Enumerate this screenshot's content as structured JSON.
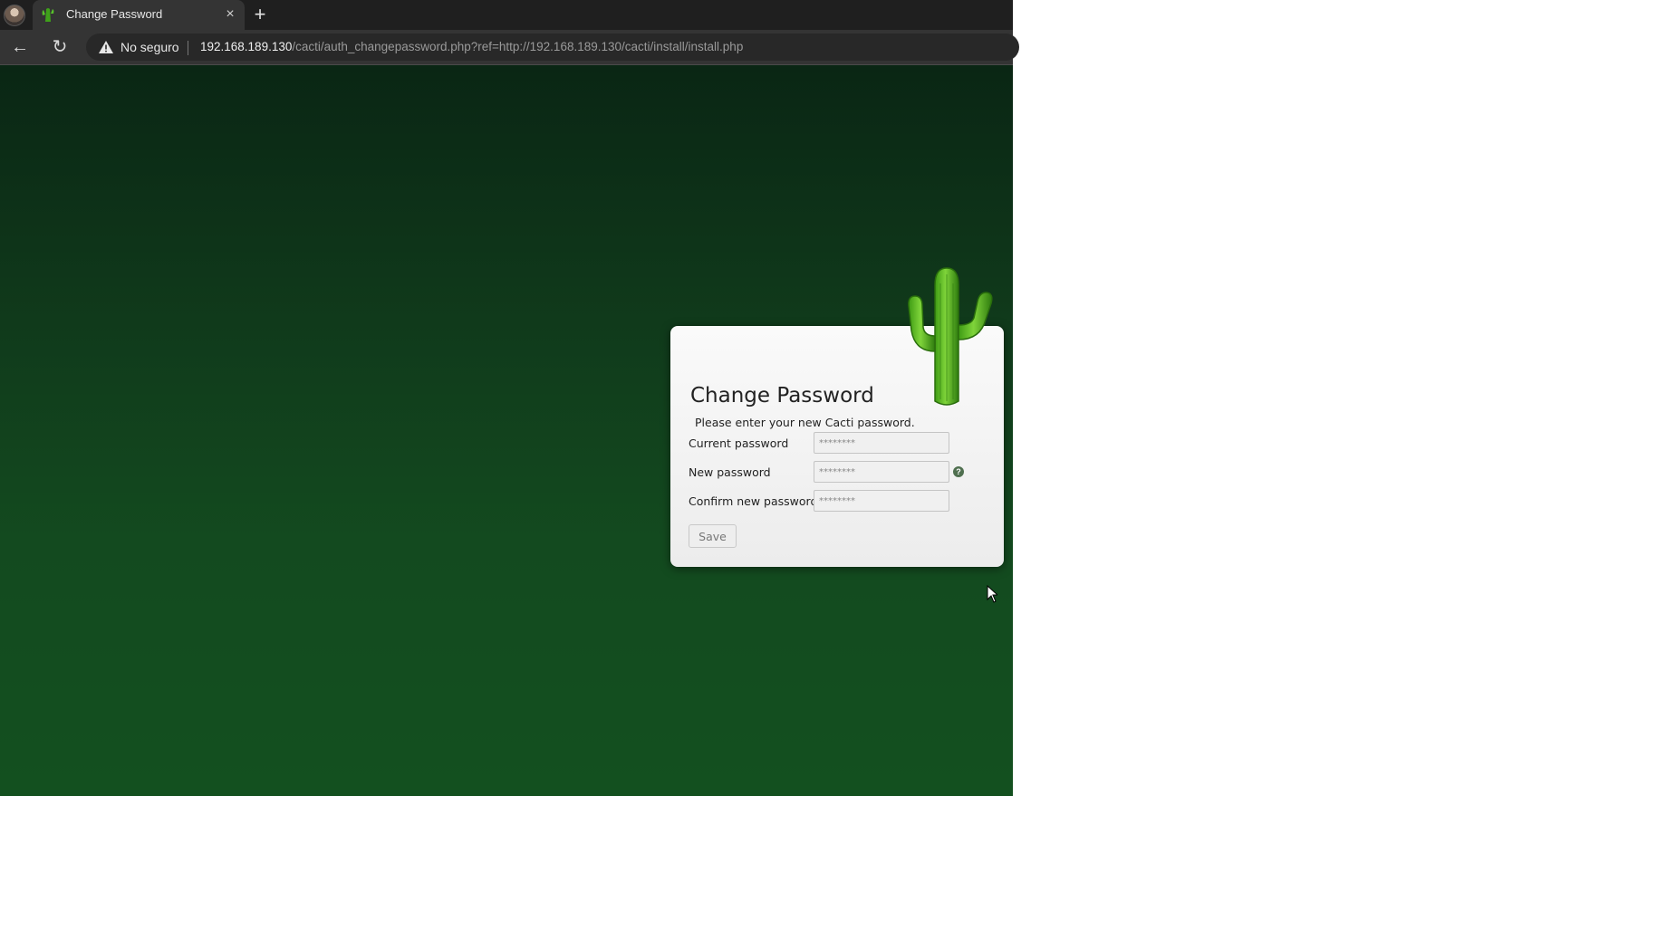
{
  "browser": {
    "tab": {
      "title": "Change Password",
      "close_glyph": "×",
      "favicon": "cactus-favicon"
    },
    "new_tab_glyph": "+",
    "toolbar": {
      "back_glyph": "←",
      "reload_glyph": "↻",
      "security_label": "No seguro",
      "url_host": "192.168.189.130",
      "url_path": "/cacti/auth_changepassword.php?ref=http://192.168.189.130/cacti/install/install.php"
    }
  },
  "page": {
    "background_color": "#0f3d1a",
    "card": {
      "title": "Change Password",
      "subtitle": "Please enter your new Cacti password.",
      "fields": [
        {
          "label": "Current password",
          "placeholder": "********"
        },
        {
          "label": "New password",
          "placeholder": "********",
          "help": "?"
        },
        {
          "label": "Confirm new password",
          "placeholder": "********"
        }
      ],
      "save_label": "Save"
    }
  },
  "colors": {
    "accent_green": "#4caf1f",
    "page_bg": "#0f3d1a",
    "help_icon": "#4f6f4f"
  }
}
